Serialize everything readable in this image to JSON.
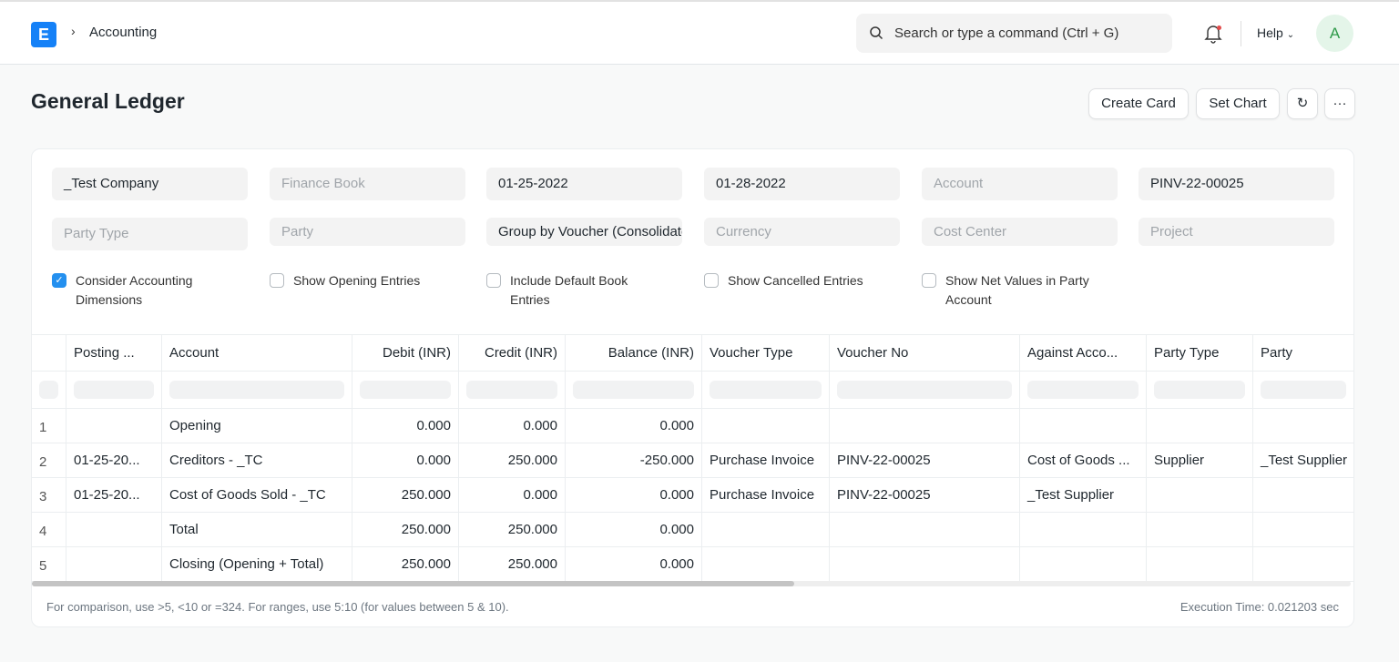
{
  "nav": {
    "logo": "E",
    "breadcrumb": "Accounting",
    "search_placeholder": "Search or type a command (Ctrl + G)",
    "help": "Help",
    "avatar": "A"
  },
  "page": {
    "title": "General Ledger",
    "create_card": "Create Card",
    "set_chart": "Set Chart"
  },
  "filters": {
    "row1": [
      {
        "v": "_Test Company",
        "ph": false
      },
      {
        "v": "Finance Book",
        "ph": true
      },
      {
        "v": "01-25-2022",
        "ph": false
      },
      {
        "v": "01-28-2022",
        "ph": false
      },
      {
        "v": "Account",
        "ph": true
      },
      {
        "v": "PINV-22-00025",
        "ph": false
      }
    ],
    "row2": [
      {
        "v": "Party Type",
        "ph": true
      },
      {
        "v": "Party",
        "ph": true
      },
      {
        "v": "Group by Voucher (Consolidated)",
        "ph": false
      },
      {
        "v": "Currency",
        "ph": true
      },
      {
        "v": "Cost Center",
        "ph": true
      },
      {
        "v": "Project",
        "ph": true
      }
    ],
    "checks": [
      {
        "label": "Consider Accounting Dimensions",
        "checked": true
      },
      {
        "label": "Show Opening Entries",
        "checked": false
      },
      {
        "label": "Include Default Book Entries",
        "checked": false
      },
      {
        "label": "Show Cancelled Entries",
        "checked": false
      },
      {
        "label": "Show Net Values in Party Account",
        "checked": false
      }
    ]
  },
  "table": {
    "columns": [
      "",
      "Posting ...",
      "Account",
      "Debit (INR)",
      "Credit (INR)",
      "Balance (INR)",
      "Voucher Type",
      "Voucher No",
      "Against Acco...",
      "Party Type",
      "Party"
    ],
    "rows": [
      [
        "1",
        "",
        "Opening",
        "0.000",
        "0.000",
        "0.000",
        "",
        "",
        "",
        "",
        ""
      ],
      [
        "2",
        "01-25-20...",
        "Creditors - _TC",
        "0.000",
        "250.000",
        "-250.000",
        "Purchase Invoice",
        "PINV-22-00025",
        "Cost of Goods ...",
        "Supplier",
        "_Test Supplier"
      ],
      [
        "3",
        "01-25-20...",
        "Cost of Goods Sold - _TC",
        "250.000",
        "0.000",
        "0.000",
        "Purchase Invoice",
        "PINV-22-00025",
        "_Test Supplier",
        "",
        ""
      ],
      [
        "4",
        "",
        "Total",
        "250.000",
        "250.000",
        "0.000",
        "",
        "",
        "",
        "",
        ""
      ],
      [
        "5",
        "",
        "Closing (Opening + Total)",
        "250.000",
        "250.000",
        "0.000",
        "",
        "",
        "",
        "",
        ""
      ]
    ]
  },
  "footer": {
    "hint": "For comparison, use >5, <10 or =324. For ranges, use 5:10 (for values between 5 & 10).",
    "exec": "Execution Time: 0.021203 sec"
  }
}
